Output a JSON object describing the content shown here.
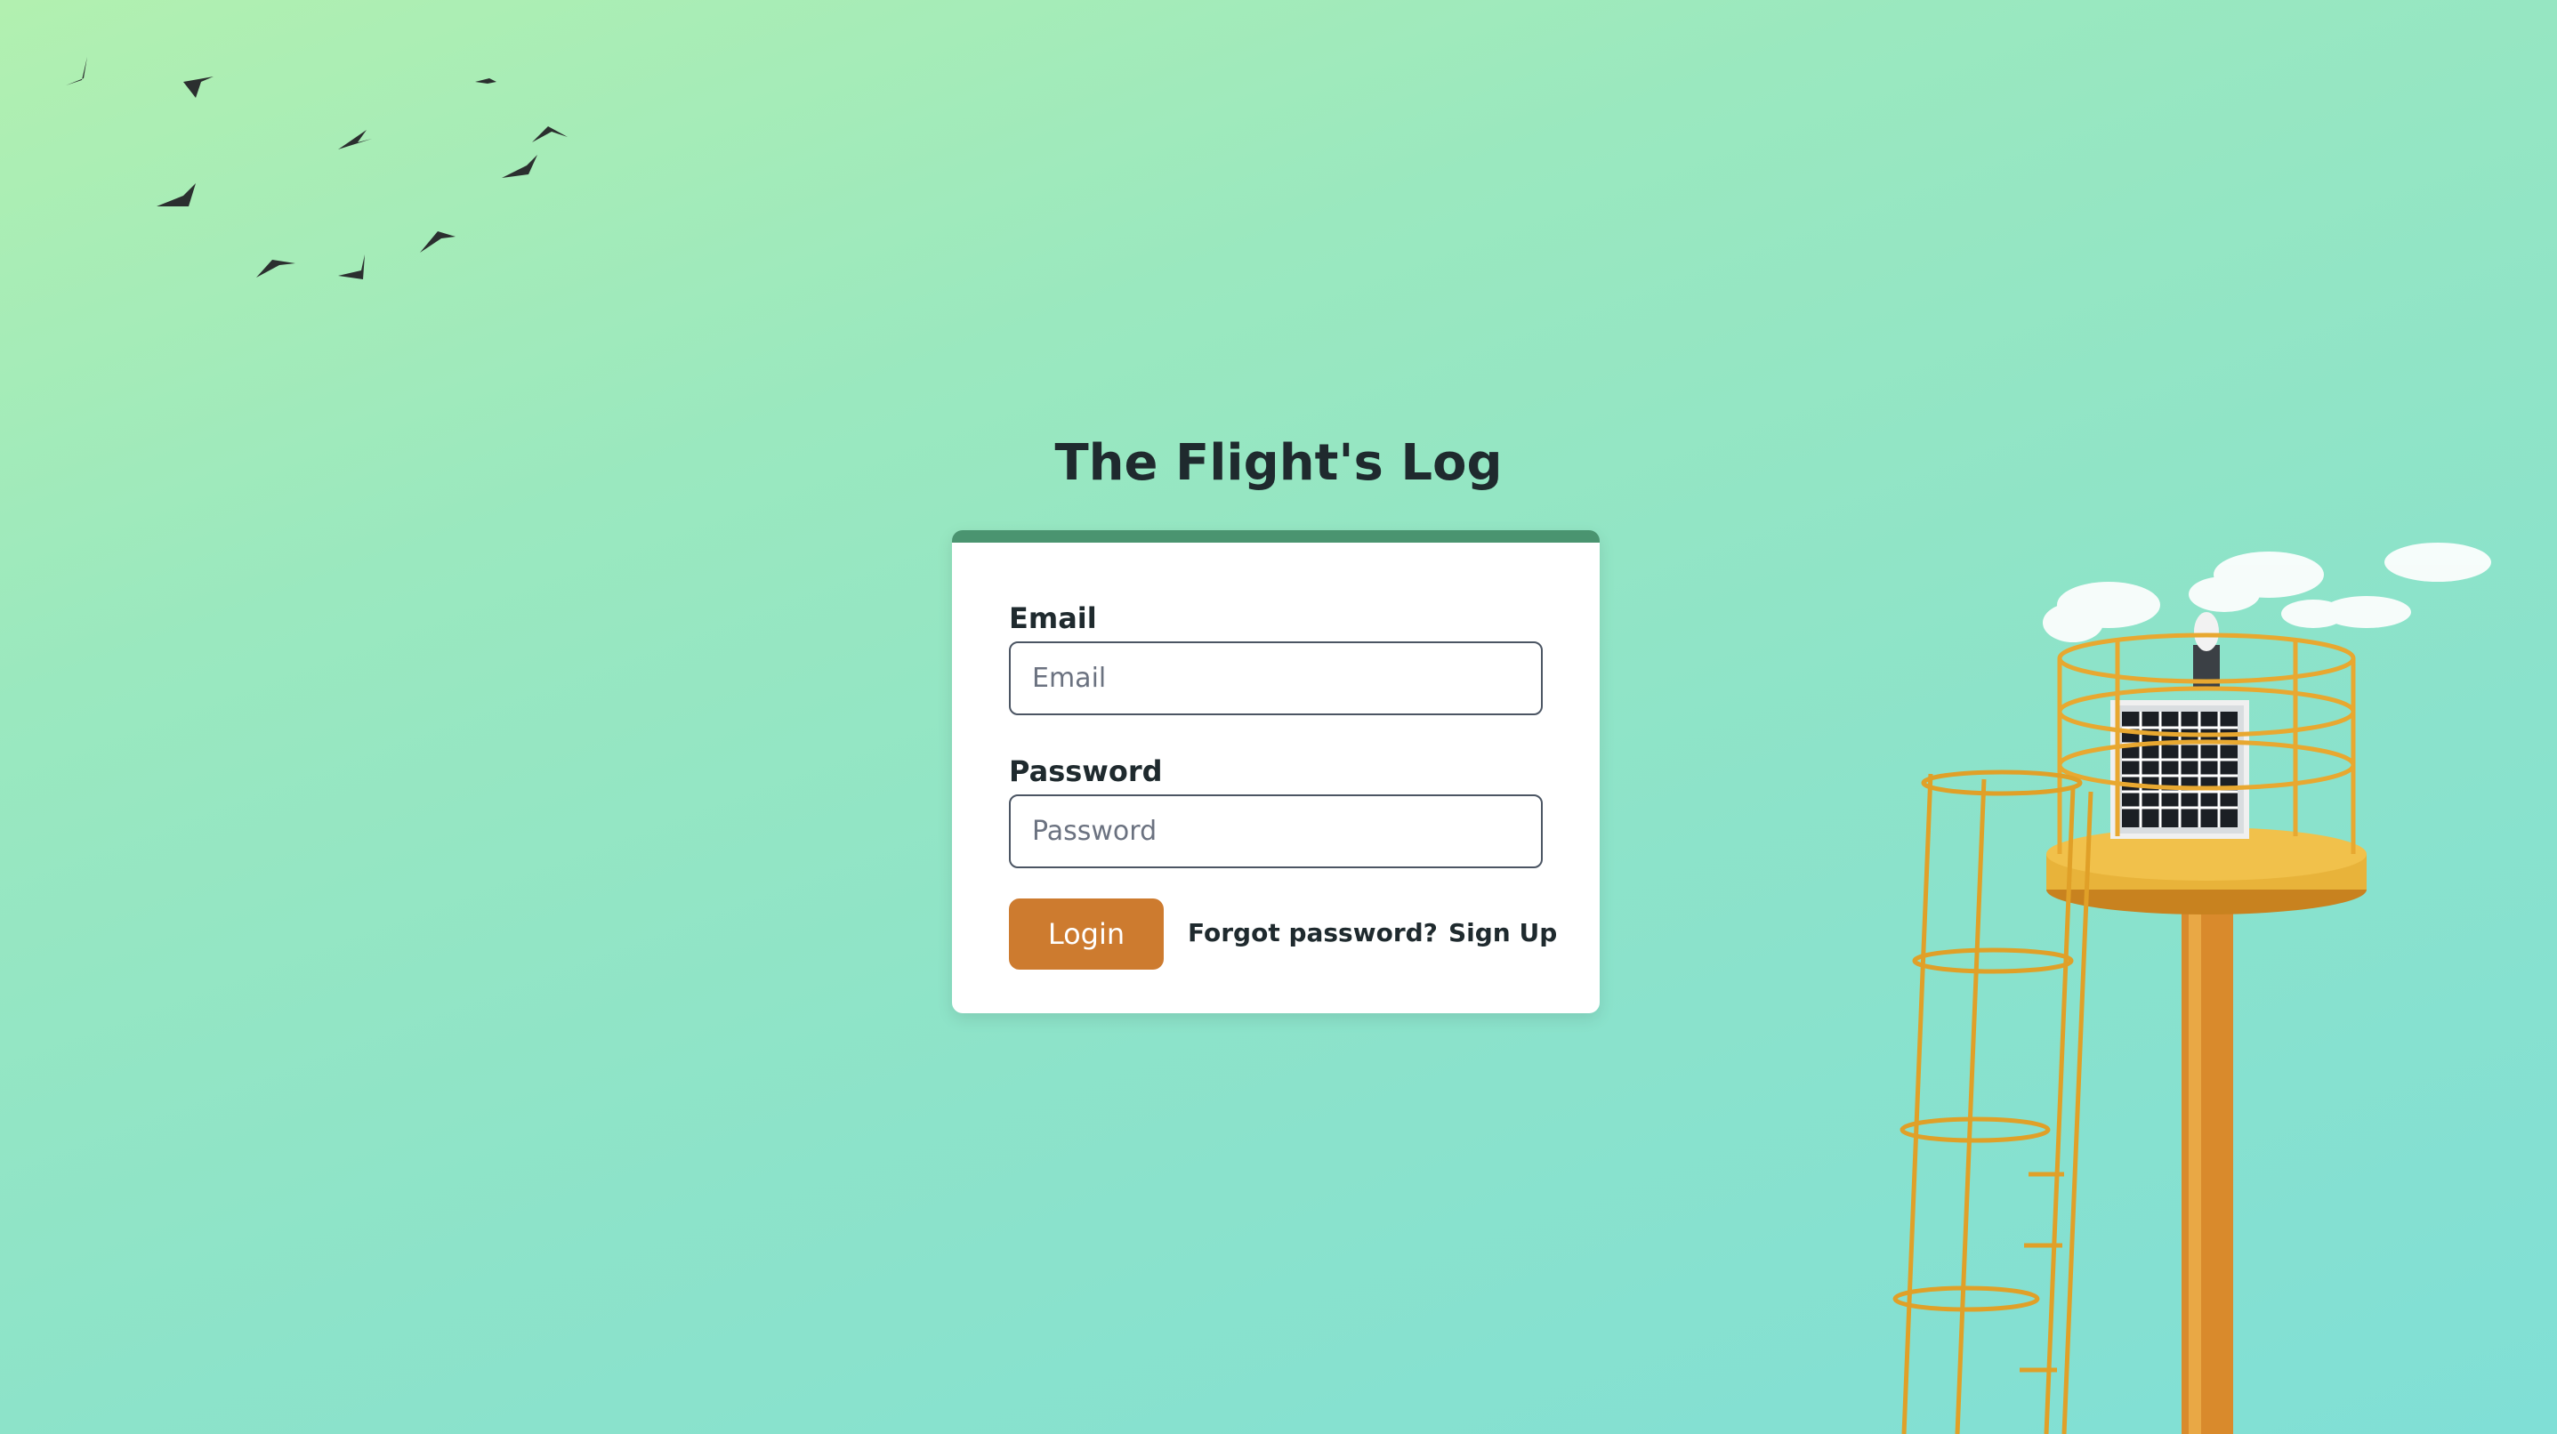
{
  "app": {
    "title": "The Flight's Log"
  },
  "login_form": {
    "email_label": "Email",
    "email_placeholder": "Email",
    "email_value": "",
    "password_label": "Password",
    "password_placeholder": "Password",
    "password_value": "",
    "login_label": "Login",
    "forgot_password_label": "Forgot password?",
    "sign_up_label": "Sign Up"
  },
  "colors": {
    "background_gradient": [
      "#b2f0b0",
      "#80dfd6"
    ],
    "card_accent": "#4a9470",
    "login_button": "#cd7b2f",
    "text": "#1f2a2e"
  },
  "decorations": {
    "birds": "flock-of-birds-image",
    "tower": "yellow-beacon-tower-image",
    "clouds": "cloud-image"
  }
}
